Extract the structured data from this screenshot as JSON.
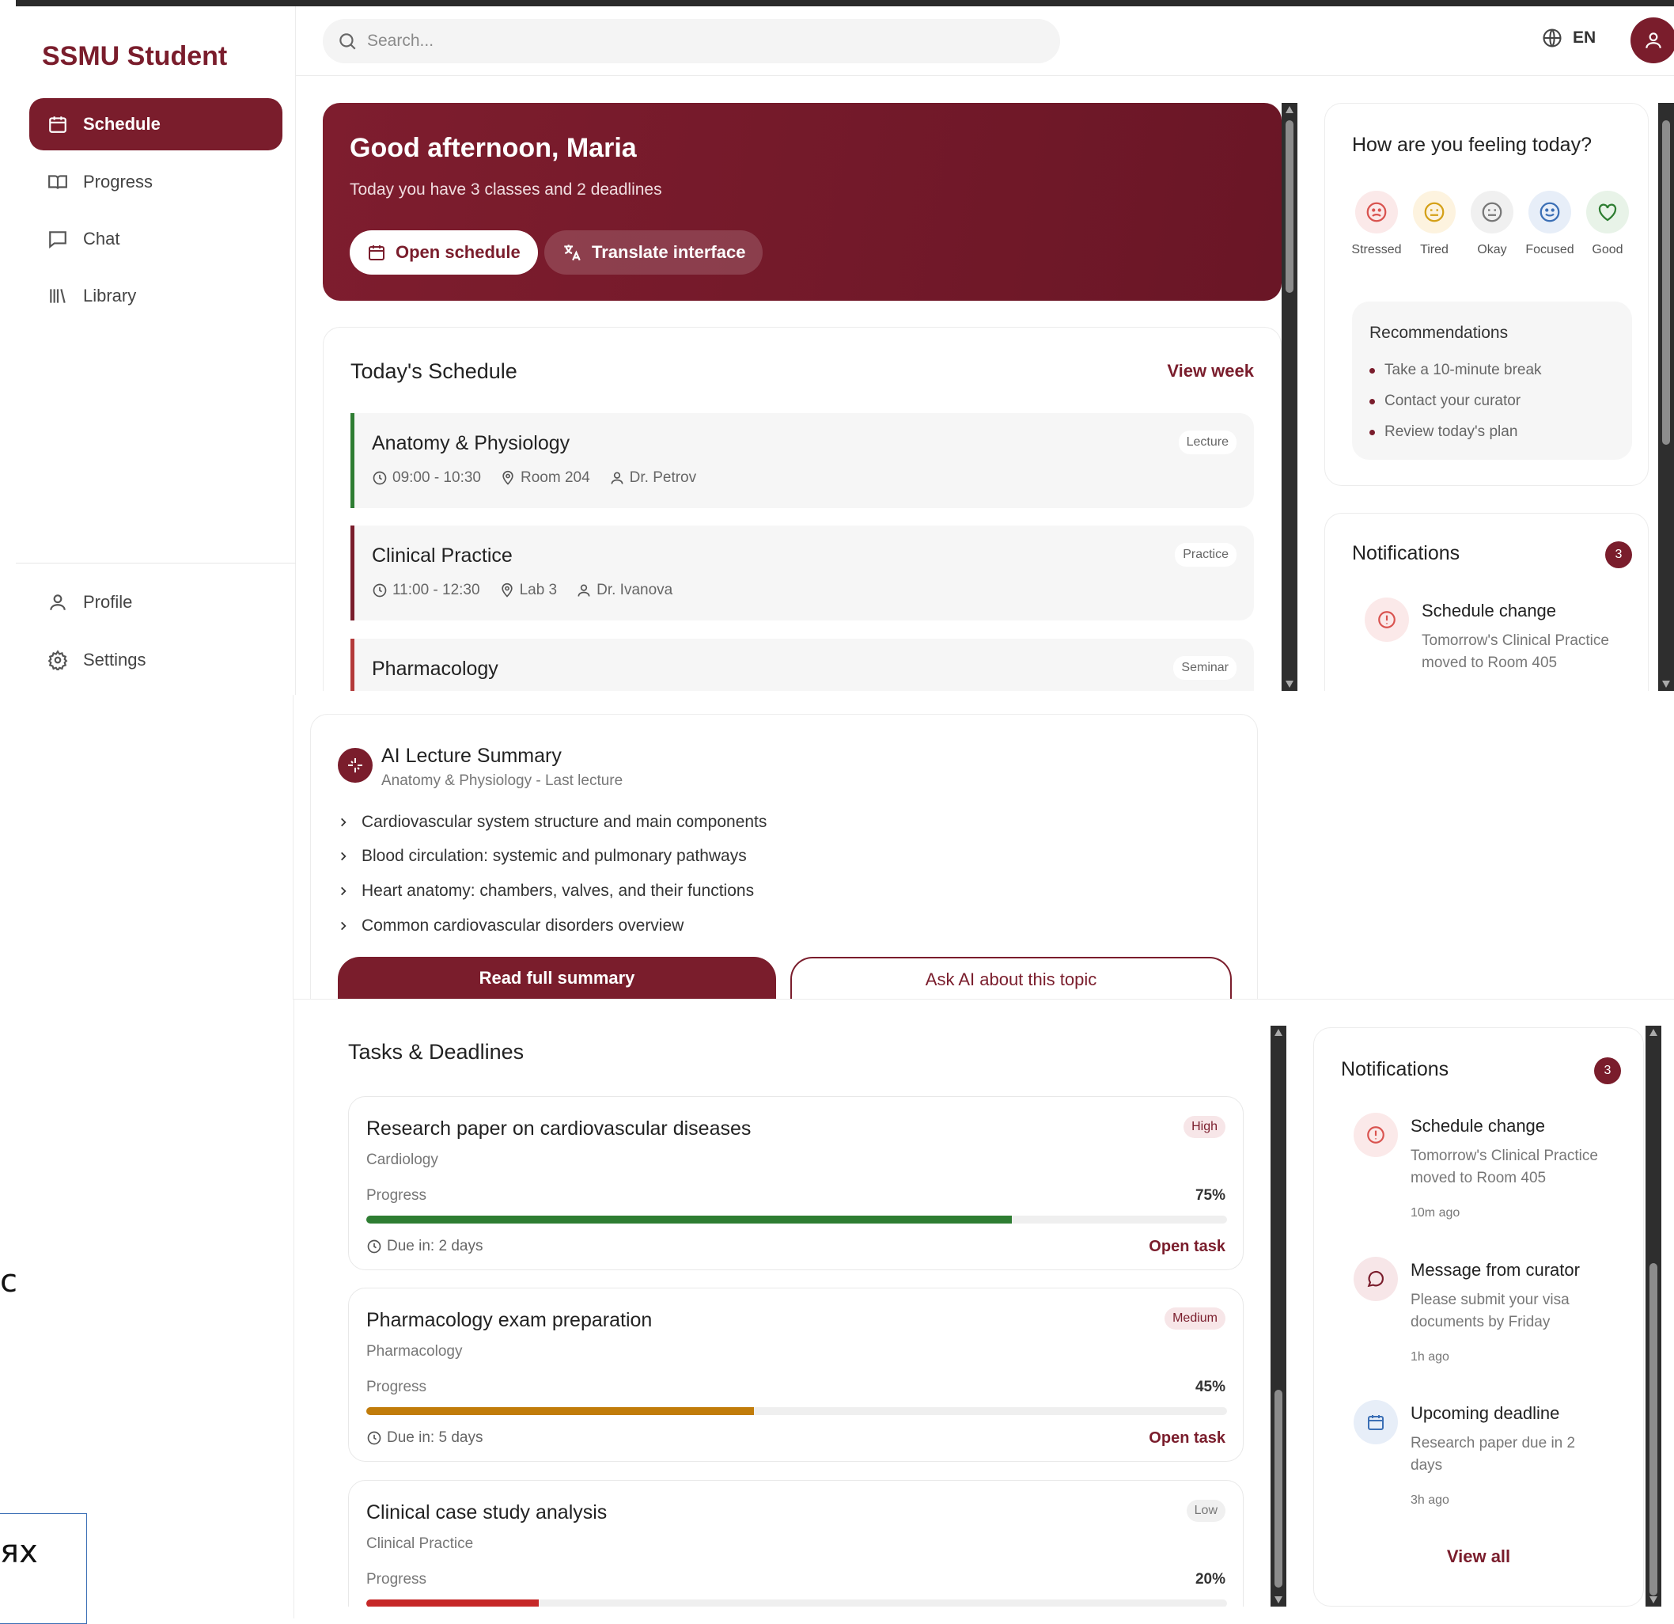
{
  "brand": "SSMU Student",
  "sidebar": {
    "items": [
      {
        "label": "Schedule",
        "icon": "calendar-icon"
      },
      {
        "label": "Progress",
        "icon": "book-icon"
      },
      {
        "label": "Chat",
        "icon": "chat-icon"
      },
      {
        "label": "Library",
        "icon": "library-icon"
      }
    ],
    "bottom_items": [
      {
        "label": "Profile",
        "icon": "user-icon"
      },
      {
        "label": "Settings",
        "icon": "gear-icon"
      }
    ]
  },
  "header": {
    "search_placeholder": "Search...",
    "language": "EN"
  },
  "hero": {
    "title": "Good afternoon, Maria",
    "subtitle": "Today you have 3 classes and 2 deadlines",
    "open_schedule": "Open schedule",
    "translate": "Translate interface"
  },
  "schedule": {
    "title": "Today's Schedule",
    "view_week": "View week",
    "classes": [
      {
        "name": "Anatomy & Physiology",
        "time": "09:00 - 10:30",
        "room": "Room 204",
        "teacher": "Dr. Petrov",
        "type": "Lecture",
        "color": "#2e7d32"
      },
      {
        "name": "Clinical Practice",
        "time": "11:00 - 12:30",
        "room": "Lab 3",
        "teacher": "Dr. Ivanova",
        "type": "Practice",
        "color": "#7a1d2c"
      },
      {
        "name": "Pharmacology",
        "type": "Seminar",
        "color": "#b33a3a"
      }
    ]
  },
  "mood": {
    "title": "How are you feeling today?",
    "options": [
      {
        "label": "Stressed",
        "icon": "sad-face-icon",
        "color": "#d9534f"
      },
      {
        "label": "Tired",
        "icon": "neutral-face-icon",
        "color": "#d4a017"
      },
      {
        "label": "Okay",
        "icon": "neutral-face-icon",
        "color": "#777777"
      },
      {
        "label": "Focused",
        "icon": "smile-face-icon",
        "color": "#3b6fb5"
      },
      {
        "label": "Good",
        "icon": "heart-icon",
        "color": "#2e7d32"
      }
    ],
    "recommendations_title": "Recommendations",
    "recommendations": [
      "Take a 10-minute break",
      "Contact your curator",
      "Review today's plan"
    ]
  },
  "notifications": {
    "title": "Notifications",
    "count": "3",
    "items": [
      {
        "title": "Schedule change",
        "desc": "Tomorrow's Clinical Practice moved to Room 405",
        "time": "10m ago",
        "icon": "alert-icon"
      },
      {
        "title": "Message from curator",
        "desc": "Please submit your visa documents by Friday",
        "time": "1h ago",
        "icon": "message-icon"
      },
      {
        "title": "Upcoming deadline",
        "desc": "Research paper due in 2 days",
        "time": "3h ago",
        "icon": "calendar-icon"
      }
    ],
    "view_all": "View all"
  },
  "ai_summary": {
    "title": "AI Lecture Summary",
    "subtitle": "Anatomy & Physiology - Last lecture",
    "points": [
      "Cardiovascular system structure and main components",
      "Blood circulation: systemic and pulmonary pathways",
      "Heart anatomy: chambers, valves, and their functions",
      "Common cardiovascular disorders overview"
    ],
    "read_full": "Read full summary",
    "ask_ai": "Ask AI about this topic"
  },
  "tasks": {
    "title": "Tasks & Deadlines",
    "progress_label": "Progress",
    "open_task": "Open task",
    "items": [
      {
        "name": "Research paper on cardiovascular diseases",
        "subject": "Cardiology",
        "priority": "High",
        "progress": 75,
        "progress_text": "75%",
        "due": "Due in: 2 days",
        "color": "#2e7d32"
      },
      {
        "name": "Pharmacology exam preparation",
        "subject": "Pharmacology",
        "priority": "Medium",
        "progress": 45,
        "progress_text": "45%",
        "due": "Due in: 5 days",
        "color": "#c17c0a"
      },
      {
        "name": "Clinical case study analysis",
        "subject": "Clinical Practice",
        "priority": "Low",
        "progress": 20,
        "progress_text": "20%",
        "due": "",
        "color": "#c62828"
      }
    ]
  },
  "fragments": {
    "left_glyph": "с",
    "bottom_text": "ях"
  }
}
